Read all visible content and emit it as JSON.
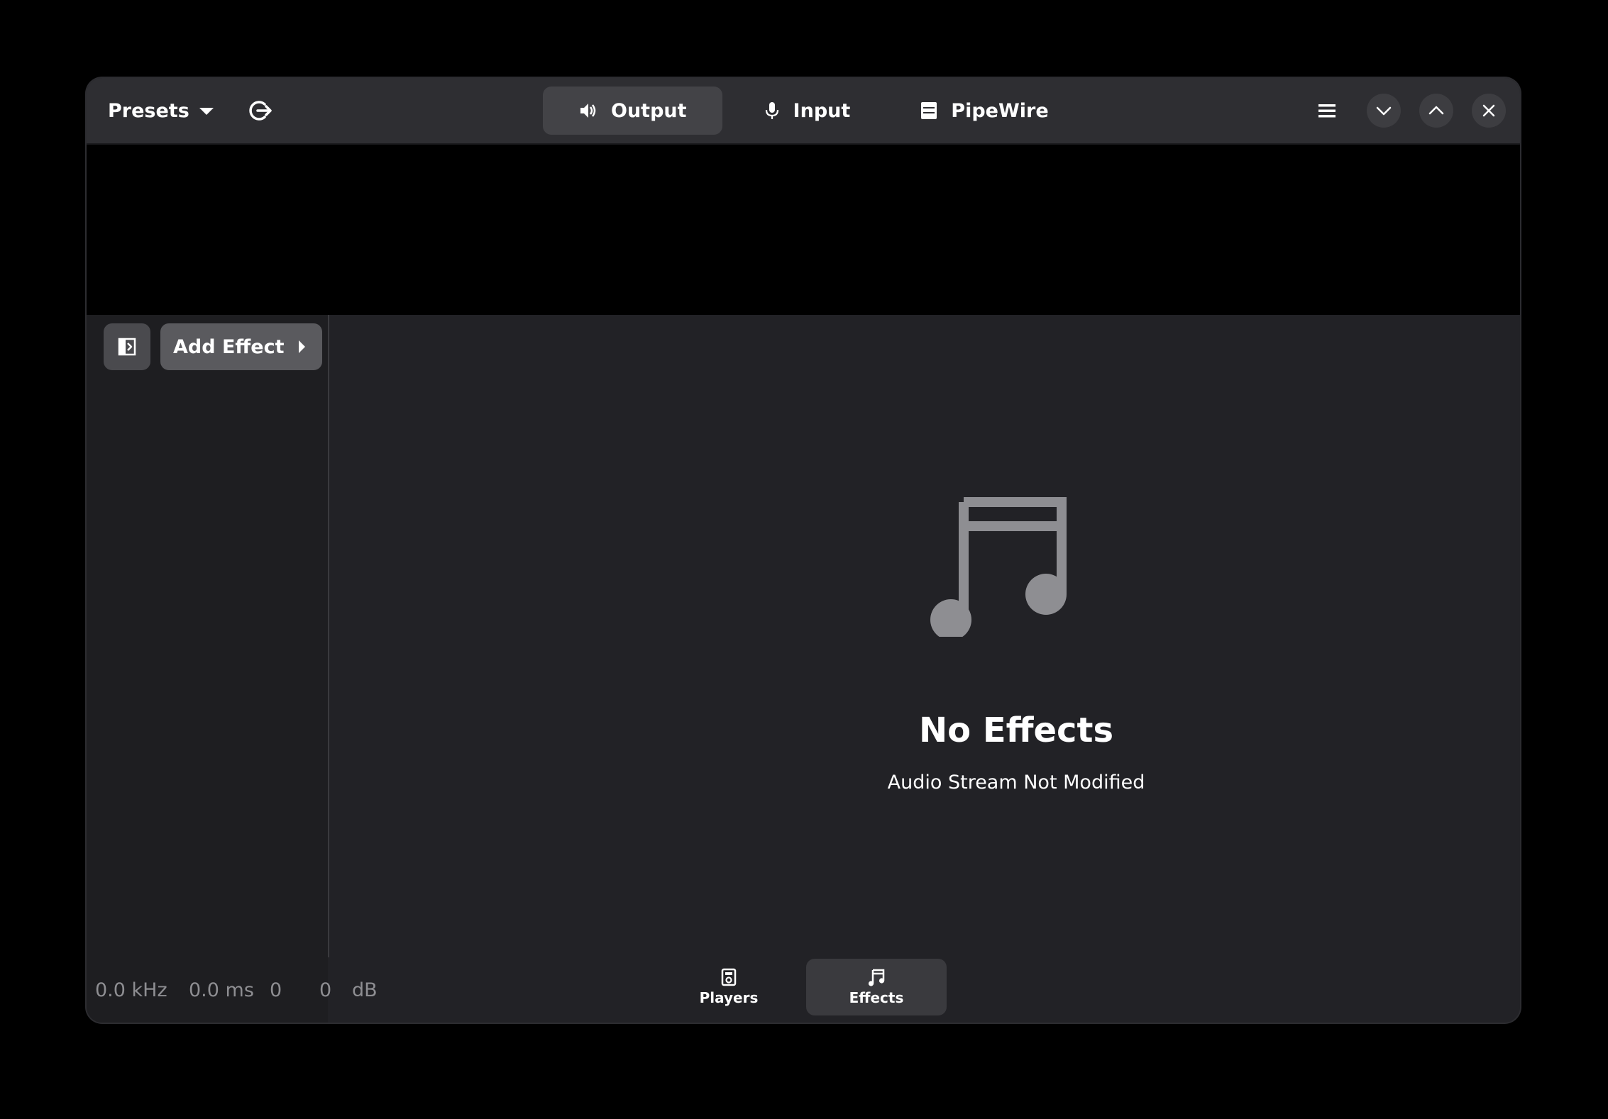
{
  "header": {
    "presets_label": "Presets",
    "tabs": [
      {
        "label": "Output",
        "icon": "speaker-icon",
        "active": true
      },
      {
        "label": "Input",
        "icon": "microphone-icon",
        "active": false
      },
      {
        "label": "PipeWire",
        "icon": "server-icon",
        "active": false
      }
    ]
  },
  "sidebar": {
    "add_effect_label": "Add Effect"
  },
  "main": {
    "status_title": "No Effects",
    "status_description": "Audio Stream Not Modified",
    "status_icon": "music-note-icon"
  },
  "statusbar": {
    "sample_rate": "0.0 kHz",
    "latency": "0.0 ms",
    "level_left": "0",
    "level_right": "0",
    "level_unit": "dB"
  },
  "view_switcher": [
    {
      "label": "Players",
      "icon": "media-player-icon",
      "active": false
    },
    {
      "label": "Effects",
      "icon": "music-note-icon",
      "active": true
    }
  ],
  "colors": {
    "window_bg": "#222226",
    "header_bg": "#2e2e32",
    "sidebar_bg": "#1e1e21",
    "active_tab_bg": "#434347",
    "muted_text": "#8e8e92",
    "icon_gray": "#8e8e92"
  }
}
